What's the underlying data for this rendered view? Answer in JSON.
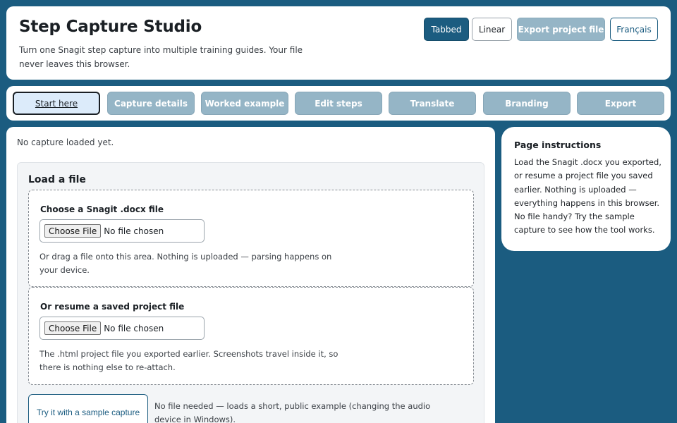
{
  "header": {
    "title": "Step Capture Studio",
    "subtitle": "Turn one Snagit step capture into multiple training guides. Your file never leaves this browser.",
    "buttons": {
      "tabbed": "Tabbed",
      "linear": "Linear",
      "export_project": "Export project file",
      "language": "Français"
    }
  },
  "tabs": [
    {
      "label": "Start here",
      "active": true
    },
    {
      "label": "Capture details",
      "active": false
    },
    {
      "label": "Worked example",
      "active": false
    },
    {
      "label": "Edit steps",
      "active": false
    },
    {
      "label": "Translate",
      "active": false
    },
    {
      "label": "Branding",
      "active": false
    },
    {
      "label": "Export",
      "active": false
    }
  ],
  "main": {
    "status": "No capture loaded yet.",
    "load": {
      "title": "Load a file",
      "docx": {
        "label": "Choose a Snagit .docx file",
        "button": "Choose File",
        "file_status": "No file chosen",
        "help": "Or drag a file onto this area. Nothing is uploaded — parsing happens on your device."
      },
      "project": {
        "label": "Or resume a saved project file",
        "button": "Choose File",
        "file_status": "No file chosen",
        "help": "The .html project file you exported earlier. Screenshots travel inside it, so there is nothing else to re-attach."
      },
      "sample": {
        "button": "Try it with a sample capture",
        "note": "No file needed — loads a short, public example (changing the audio device in Windows)."
      }
    }
  },
  "instructions": {
    "title": "Page instructions",
    "body": "Load the Snagit .docx you exported, or resume a project file you saved earlier. Nothing is uploaded — everything happens in this browser. No file handy? Try the sample capture to see how the tool works."
  },
  "colors": {
    "background": "#1b5c80",
    "primary": "#1b5c80",
    "disabled": "#95b5c6",
    "active_tab": "#dcebfa"
  }
}
